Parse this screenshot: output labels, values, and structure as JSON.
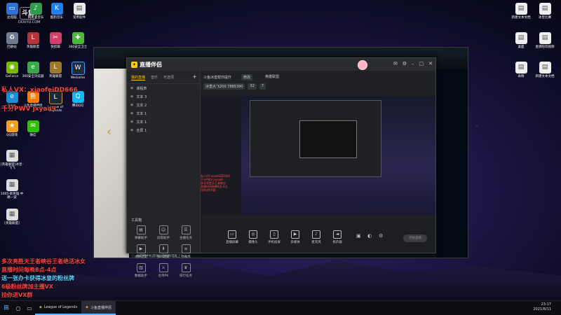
{
  "watermark": {
    "logo": "斗鱼",
    "domain": "DOUYU.COM"
  },
  "desktop_icons": [
    {
      "label": "此电脑",
      "icon": "computer-icon"
    },
    {
      "label": "网易云音乐",
      "icon": "music-icon"
    },
    {
      "label": "酷狗音乐",
      "icon": "kugou-icon"
    },
    {
      "label": "常用软件",
      "icon": "folder-icon"
    },
    {
      "label": "回收站",
      "icon": "recycle-bin-icon"
    },
    {
      "label": "英雄联盟",
      "icon": "lol-icon"
    },
    {
      "label": "快剪辑",
      "icon": "clip-icon"
    },
    {
      "label": "360安全卫士",
      "icon": "shield-icon"
    },
    {
      "label": "GeForce",
      "icon": "nvidia-icon"
    },
    {
      "label": "360安全浏览器",
      "icon": "browser-icon"
    },
    {
      "label": "英雄联盟",
      "icon": "lol-icon"
    },
    {
      "label": "WeGame",
      "icon": "wegame-icon"
    },
    {
      "label": "Edge",
      "icon": "edge-icon"
    },
    {
      "label": "斗鱼直播伴侣",
      "icon": "douyu-icon"
    },
    {
      "label": "League of Legends",
      "icon": "lol-icon"
    },
    {
      "label": "腾讯QQ",
      "icon": "qq-icon"
    },
    {
      "label": "QQ游戏",
      "icon": "game-icon"
    },
    {
      "label": "微信",
      "icon": "wechat-icon"
    },
    {
      "label": "[英雄联盟]冰皇-飞飞",
      "icon": "file-icon"
    },
    {
      "label": "1005-新英雄 中路一波",
      "icon": "file-icon"
    },
    {
      "label": "[英雄联盟]",
      "icon": "file-icon"
    }
  ],
  "right_icons": [
    {
      "label": "新建文本文档",
      "icon": "file-icon"
    },
    {
      "label": "冰皇比赛",
      "icon": "file-icon"
    },
    {
      "label": "桌面",
      "icon": "file-icon"
    },
    {
      "label": "金牌陪玩视频",
      "icon": "file-icon"
    },
    {
      "label": "表情",
      "icon": "file-icon"
    },
    {
      "label": "新建文本文档",
      "icon": "file-icon"
    }
  ],
  "overlay": {
    "wechat_private": "私人VX：xiaofeiDD666",
    "qiangfen": "千分PWV jxyaa9",
    "lines": [
      "多次亮胜天王者峡谷王者绝活冰女",
      "直播时间每晚8点-4点",
      "送一张办卡获得冰皇的粉丝牌",
      "6级粉丝牌加主播VX",
      "拉你进VX群"
    ]
  },
  "streamer": {
    "title": "直播伴侣",
    "tabs": [
      "我的直播",
      "音乐",
      "可选项"
    ],
    "sources": [
      "课程表",
      "文本 3",
      "文本 2",
      "文本 1",
      "文本 1",
      "全屏 1"
    ],
    "room_title": "斗鱼冰皇帮你提升",
    "room_tag_btn": "修改",
    "room_category": "英雄联盟",
    "room_hint": "冰皇大飞200 7885390",
    "room_count": "32",
    "room_share_count": "7",
    "tools_title": "工具箱",
    "tools": [
      "弹幕助手",
      "房管助手",
      "主播任务",
      "视频连麦",
      "多人连麦",
      "弹幕库",
      "数据助手",
      "主持PK",
      "排行任务"
    ],
    "controls": [
      "直播屏幕",
      "摄像头",
      "手机投屏",
      "多媒体",
      "麦克风",
      "扬声器"
    ],
    "live_button": "开始直播",
    "notice": "如何把手机游戏画面搬到电脑上?",
    "preview_lines": [
      "私人VX:xiaofeiDD666",
      "千分PWV jxyaa9",
      "多次亮胜天王者峡谷",
      "直播时间每晚8点-4点",
      "拉你进VX群"
    ]
  },
  "taskbar": {
    "apps": [
      "League of Legends",
      "斗鱼直播伴侣"
    ],
    "time": "23:17",
    "date": "2021/8/11"
  }
}
